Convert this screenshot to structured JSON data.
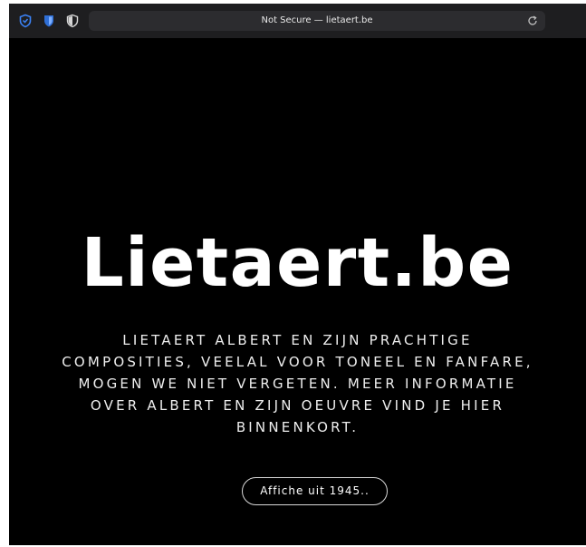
{
  "browser": {
    "address_bar": "Not Secure — lietaert.be",
    "icons": [
      "privacy-shield-icon",
      "bitwarden-shield-icon",
      "privacy-badger-shield-icon",
      "reload-icon"
    ]
  },
  "page": {
    "title": "Lietaert.be",
    "intro_lines": [
      "LIETAERT ALBERT EN ZIJN PRACHTIGE",
      "COMPOSITIES, VEELAL VOOR TONEEL EN FANFARE,",
      "MOGEN WE NIET VERGETEN. MEER INFORMATIE",
      "OVER ALBERT EN ZIJN OEUVRE VIND JE HIER",
      "BINNENKORT."
    ],
    "button_label": "Affiche uit 1945.."
  },
  "colors": {
    "background": "#000000",
    "toolbar": "#1e1e20",
    "address_bar": "#2c2c2f",
    "icon_accent": "#2f6fd6",
    "text": "#ffffff"
  }
}
